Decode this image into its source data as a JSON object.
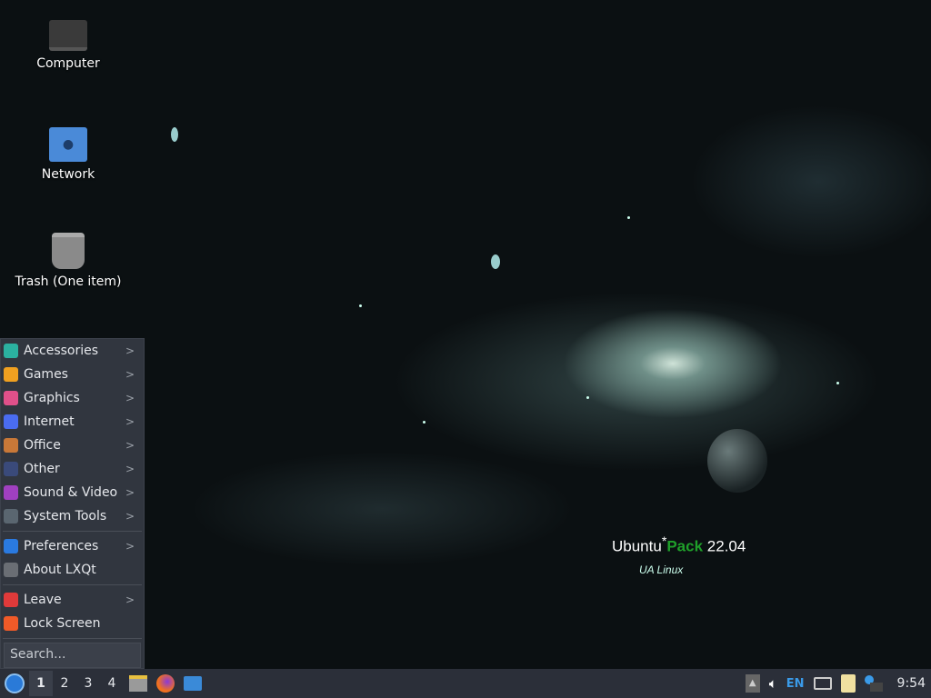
{
  "desktop": {
    "icons": [
      {
        "label": "Computer",
        "icon": "computer-icon"
      },
      {
        "label": "Network",
        "icon": "network-folder-icon"
      },
      {
        "label": "Trash (One item)",
        "icon": "trash-icon"
      }
    ]
  },
  "wallpaper": {
    "brand1": "Ubuntu",
    "brand2": "Pack",
    "version": "22.04",
    "logo": "UA Linux"
  },
  "menu": {
    "groups": [
      [
        {
          "label": "Accessories",
          "color": "#2bb1a0",
          "sub": true
        },
        {
          "label": "Games",
          "color": "#f0a020",
          "sub": true
        },
        {
          "label": "Graphics",
          "color": "#e0508a",
          "sub": true
        },
        {
          "label": "Internet",
          "color": "#4a6cf0",
          "sub": true
        },
        {
          "label": "Office",
          "color": "#c87838",
          "sub": true
        },
        {
          "label": "Other",
          "color": "#3a4a7a",
          "sub": true
        },
        {
          "label": "Sound & Video",
          "color": "#a040c0",
          "sub": true
        },
        {
          "label": "System Tools",
          "color": "#5a6670",
          "sub": true
        }
      ],
      [
        {
          "label": "Preferences",
          "color": "#2a7ae0",
          "sub": true
        },
        {
          "label": "About LXQt",
          "color": "#6a6e74",
          "sub": false
        }
      ],
      [
        {
          "label": "Leave",
          "color": "#e03a3a",
          "sub": true
        },
        {
          "label": "Lock Screen",
          "color": "#f05a28",
          "sub": false
        }
      ]
    ],
    "search_placeholder": "Search..."
  },
  "taskbar": {
    "workspaces": [
      "1",
      "2",
      "3",
      "4"
    ],
    "active_workspace": "1",
    "keyboard_layout": "EN",
    "clock": "9:54"
  }
}
